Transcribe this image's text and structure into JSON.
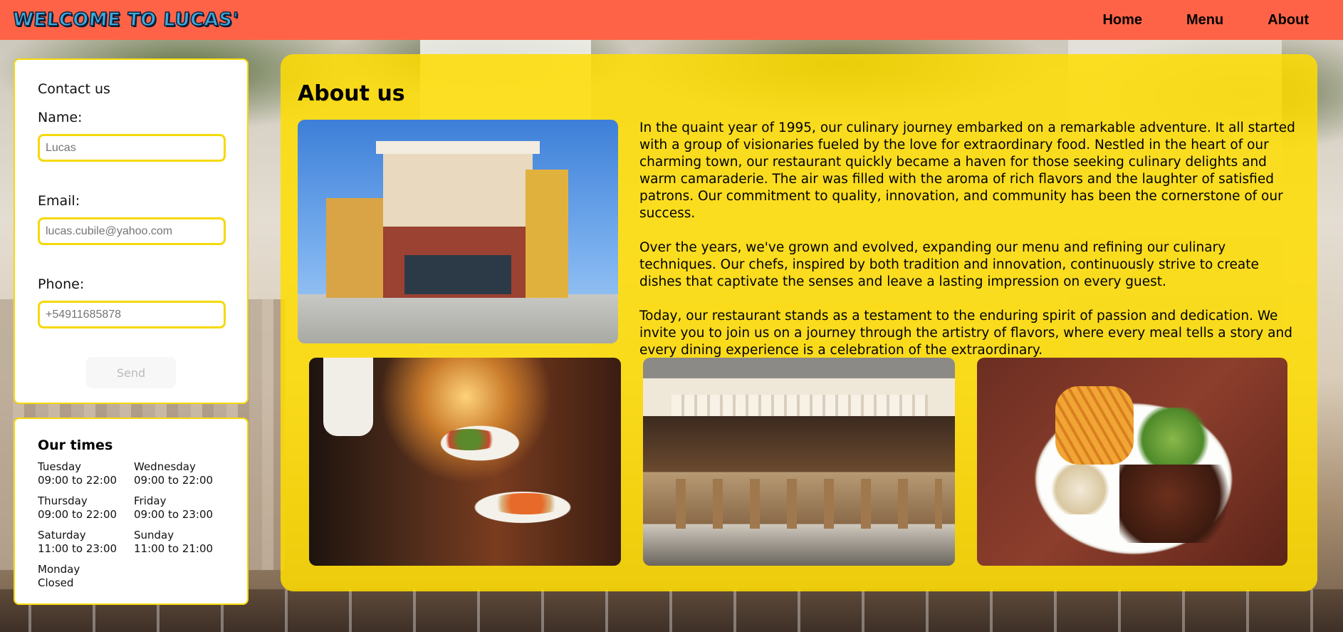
{
  "header": {
    "logo_text": "WELCOME TO LUCAS'",
    "nav": [
      "Home",
      "Menu",
      "About"
    ]
  },
  "contact": {
    "title": "Contact us",
    "name_label": "Name:",
    "name_placeholder": "Lucas",
    "email_label": "Email:",
    "email_placeholder": "lucas.cubile@yahoo.com",
    "phone_label": "Phone:",
    "phone_placeholder": "+54911685878",
    "send_label": "Send"
  },
  "times": {
    "title": "Our times",
    "items": [
      {
        "day": "Tuesday",
        "hours": "09:00 to 22:00"
      },
      {
        "day": "Wednesday",
        "hours": "09:00 to 22:00"
      },
      {
        "day": "Thursday",
        "hours": "09:00 to 22:00"
      },
      {
        "day": "Friday",
        "hours": "09:00 to 23:00"
      },
      {
        "day": "Saturday",
        "hours": "11:00 to 23:00"
      },
      {
        "day": "Sunday",
        "hours": "11:00 to 21:00"
      },
      {
        "day": "Monday",
        "hours": "Closed"
      }
    ]
  },
  "about": {
    "title": "About us",
    "paragraphs": [
      "In the quaint year of 1995, our culinary journey embarked on a remarkable adventure. It all started with a group of visionaries fueled by the love for extraordinary food. Nestled in the heart of our charming town, our restaurant quickly became a haven for those seeking culinary delights and warm camaraderie. The air was filled with the aroma of rich flavors and the laughter of satisfied patrons. Our commitment to quality, innovation, and community has been the cornerstone of our success.",
      "Over the years, we've grown and evolved, expanding our menu and refining our culinary techniques. Our chefs, inspired by both tradition and innovation, continuously strive to create dishes that captivate the senses and leave a lasting impression on every guest.",
      "Today, our restaurant stands as a testament to the enduring spirit of passion and dedication. We invite you to join us on a journey through the artistry of flavors, where every meal tells a story and every dining experience is a celebration of the extraordinary."
    ]
  },
  "colors": {
    "navbar": "#ff6347",
    "accent_yellow": "#f5d90a",
    "panel_yellow": "#ffdd00"
  }
}
